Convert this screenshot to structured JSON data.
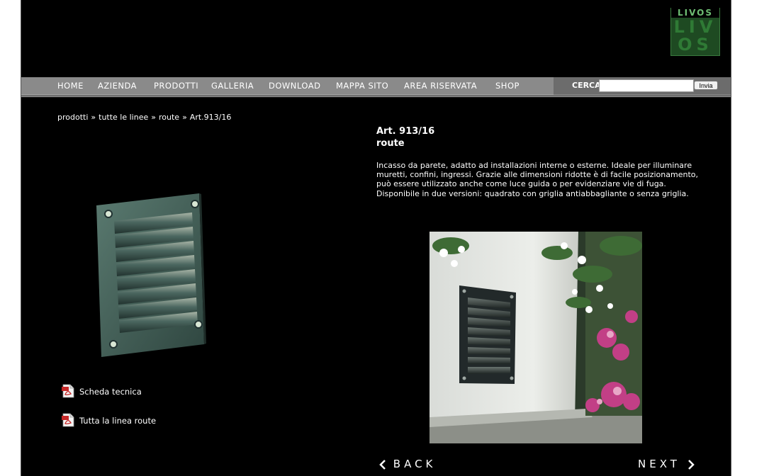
{
  "logo": {
    "top": "LIVOS",
    "big_line1": "LIV",
    "big_line2": "OS"
  },
  "nav": {
    "items": [
      {
        "label": "HOME"
      },
      {
        "label": "AZIENDA"
      },
      {
        "label": "PRODOTTI"
      },
      {
        "label": "GALLERIA"
      },
      {
        "label": "DOWNLOAD"
      },
      {
        "label": "MAPPA SITO"
      },
      {
        "label": "AREA RISERVATA"
      },
      {
        "label": "SHOP"
      }
    ],
    "search_label": "CERCA",
    "search_value": "",
    "search_button": "Invia"
  },
  "breadcrumb": {
    "items": [
      "prodotti",
      "tutte le linee",
      "route",
      "Art.913/16"
    ],
    "separator": "»"
  },
  "product": {
    "code": "Art. 913/16",
    "line": "route",
    "description": "Incasso da parete, adatto ad installazioni interne o esterne. Ideale per illuminare muretti, confini, ingressi. Grazie alle dimensioni ridotte è di facile posizionamento, può essere utilizzato anche come luce guida o per evidenziare vie di fuga. Disponibile in due versioni: quadrato con griglia antiabbagliante o senza griglia."
  },
  "downloads": [
    {
      "label": "Scheda tecnica",
      "icon": "pdf-icon"
    },
    {
      "label": "Tutta la linea route",
      "icon": "pdf-icon"
    }
  ],
  "pager": {
    "back": "BACK",
    "next": "NEXT"
  },
  "colors": {
    "background": "#000000",
    "navbar": "#8a8a8a",
    "search_area": "#6c6c6c",
    "logo_green": "#2f7a35"
  }
}
